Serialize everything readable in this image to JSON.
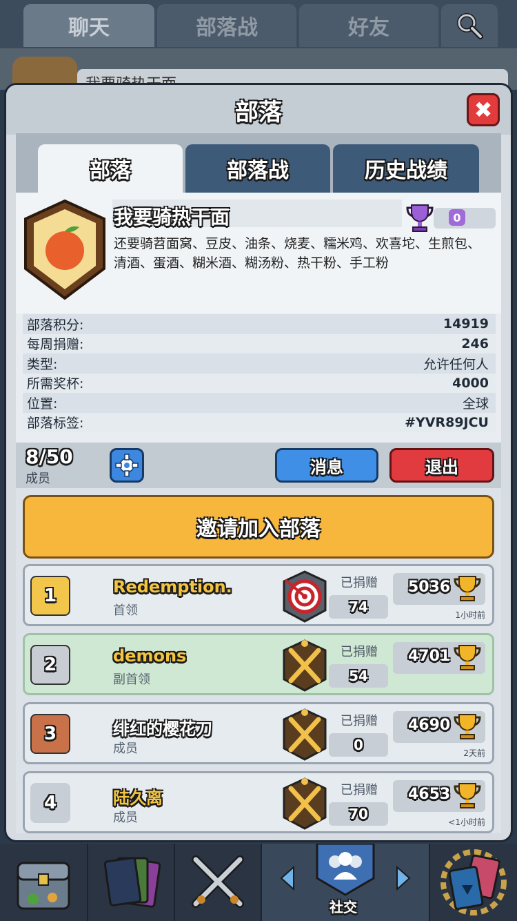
{
  "top_tabs": [
    {
      "label": "聊天"
    },
    {
      "label": "部落战"
    },
    {
      "label": "好友"
    }
  ],
  "background": {
    "card_text": "我要骑热干面"
  },
  "modal": {
    "title": "部落",
    "close": "✖"
  },
  "sub_tabs": [
    {
      "label": "部落"
    },
    {
      "label": "部落战"
    },
    {
      "label": "历史战绩"
    }
  ],
  "clan": {
    "name": "我要骑热干面",
    "trophies": "0",
    "description": "还要骑苕面窝、豆皮、油条、烧麦、糯米鸡、欢喜坨、生煎包、清酒、蛋酒、糊米酒、糊汤粉、热干粉、手工粉"
  },
  "info": [
    {
      "label": "部落积分:",
      "value": "14919"
    },
    {
      "label": "每周捐赠:",
      "value": "246"
    },
    {
      "label": "类型:",
      "value": "允许任何人"
    },
    {
      "label": "所需奖杯:",
      "value": "4000"
    },
    {
      "label": "位置:",
      "value": "全球"
    },
    {
      "label": "部落标签:",
      "value": "#YVR89JCU"
    }
  ],
  "members_bar": {
    "count": "8/50",
    "label": "成员",
    "message_btn": "消息",
    "exit_btn": "退出"
  },
  "invite_btn": "邀请加入部落",
  "donated_label": "已捐赠",
  "members": [
    {
      "rank": "1",
      "name": "Redemption.",
      "role": "首领",
      "donated": "74",
      "trophies": "5036",
      "last_seen": "1小时前"
    },
    {
      "rank": "2",
      "name": "demons",
      "role": "副首领",
      "donated": "54",
      "trophies": "4701",
      "last_seen": ""
    },
    {
      "rank": "3",
      "name": "绯红的樱花刀",
      "role": "成员",
      "donated": "0",
      "trophies": "4690",
      "last_seen": "2天前"
    },
    {
      "rank": "4",
      "name": "陆久离",
      "role": "成员",
      "donated": "70",
      "trophies": "4653",
      "last_seen": "<1小时前"
    }
  ],
  "bottom_nav": {
    "active_label": "社交"
  },
  "colors": {
    "accent_gold": "#f6b73c",
    "blue_button": "#3f8fe6",
    "red_button": "#e13a3f",
    "highlight_row": "#cfe8d3"
  }
}
